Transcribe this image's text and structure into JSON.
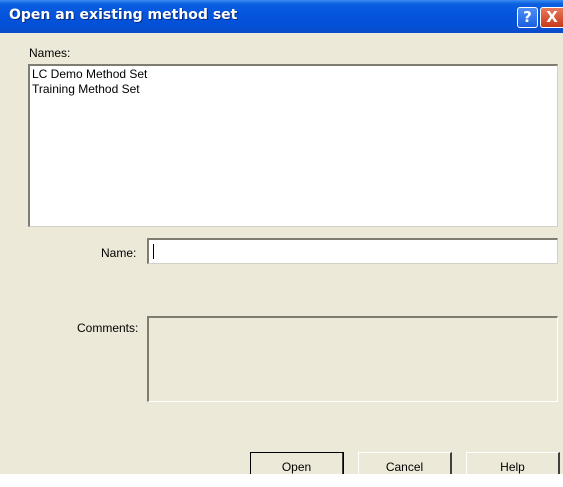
{
  "window": {
    "title": "Open an existing method set",
    "help_glyph": "?",
    "close_glyph": "X"
  },
  "names": {
    "label": "Names:",
    "items": [
      "LC Demo Method Set",
      "Training Method Set"
    ]
  },
  "name_field": {
    "label": "Name:",
    "value": ""
  },
  "comments": {
    "label": "Comments:",
    "value": ""
  },
  "buttons": {
    "open": "Open",
    "cancel": "Cancel",
    "help": "Help"
  },
  "colors": {
    "titlebar": "#0454dc",
    "dialog_bg": "#ece9d8",
    "close_button": "#c8381a"
  }
}
